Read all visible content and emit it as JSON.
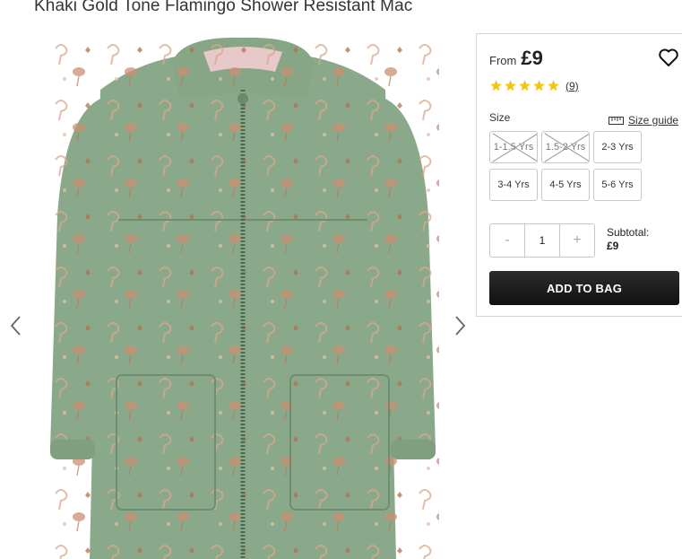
{
  "product": {
    "title": "Khaki Gold Tone Flamingo Shower Resistant Mac"
  },
  "gallery": {
    "prev_icon": "chevron-left-icon",
    "next_icon": "chevron-right-icon",
    "jacket_color": "#8aa98a",
    "print_color": "#c9967a"
  },
  "buy_panel": {
    "from_label": "From",
    "price": "£9",
    "wishlist_icon": "heart-outline-icon",
    "rating": {
      "stars": 5,
      "max": 5,
      "count_label": "(9)",
      "star_color": "#f5c518"
    },
    "size_label": "Size",
    "size_guide_label": "Size guide",
    "sizes": [
      {
        "label": "1-1.5 Yrs",
        "available": false
      },
      {
        "label": "1.5-2 Yrs",
        "available": false
      },
      {
        "label": "2-3 Yrs",
        "available": true
      },
      {
        "label": "3-4 Yrs",
        "available": true
      },
      {
        "label": "4-5 Yrs",
        "available": true
      },
      {
        "label": "5-6 Yrs",
        "available": true
      }
    ],
    "quantity": {
      "minus": "-",
      "value": "1",
      "plus": "+"
    },
    "subtotal_label": "Subtotal:",
    "subtotal_value": "£9",
    "add_to_bag_label": "ADD TO BAG",
    "add_button_color": "#1a1a1a"
  }
}
